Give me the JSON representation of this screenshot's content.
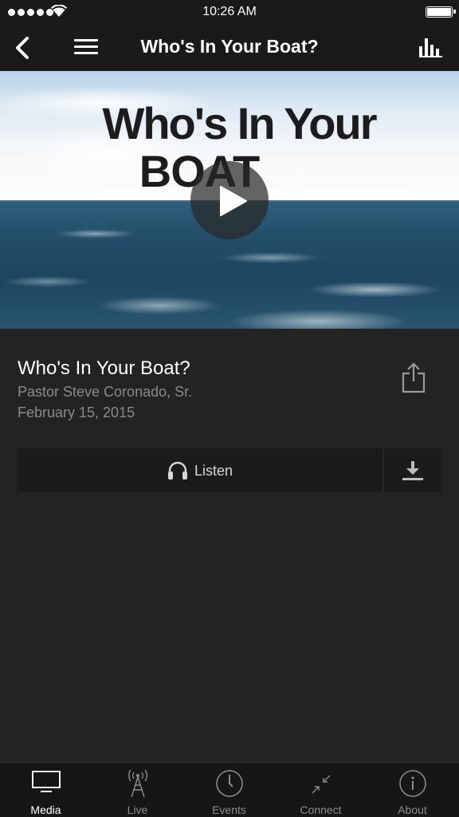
{
  "status_bar": {
    "time": "10:26 AM",
    "signal_bars": 5,
    "battery_level": 1.0
  },
  "nav": {
    "back_icon": "chevron-left-icon",
    "menu_icon": "hamburger-menu-icon",
    "title": "Who's In Your Boat?",
    "stats_icon": "bar-chart-icon"
  },
  "hero": {
    "headline": "Who's In Your",
    "subline": "BOAT",
    "play_icon": "play-icon"
  },
  "sermon": {
    "title": "Who's In Your Boat?",
    "speaker": "Pastor Steve Coronado, Sr.",
    "date": "February 15, 2015",
    "share_icon": "share-icon"
  },
  "actions": {
    "listen_label": "Listen",
    "listen_icon": "headphones-icon",
    "download_icon": "download-icon"
  },
  "tabs": [
    {
      "label": "Media",
      "icon": "tv-icon",
      "active": true
    },
    {
      "label": "Live",
      "icon": "broadcast-tower-icon",
      "active": false
    },
    {
      "label": "Events",
      "icon": "clock-icon",
      "active": false
    },
    {
      "label": "Connect",
      "icon": "arrows-in-icon",
      "active": false
    },
    {
      "label": "About",
      "icon": "info-icon",
      "active": false
    }
  ],
  "colors": {
    "background": "#232323",
    "bar": "#1a1a1a",
    "secondary_text": "#8a8a8a",
    "tab_inactive": "#8e8e8e"
  }
}
